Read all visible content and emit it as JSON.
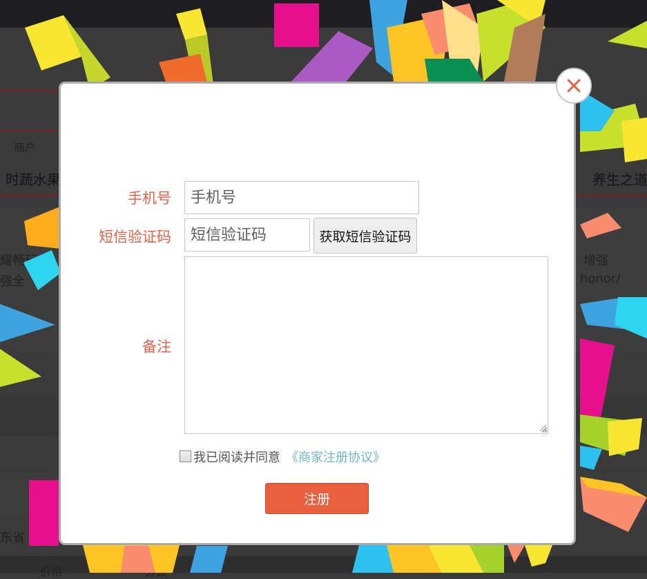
{
  "background": {
    "merchant_label": "商户",
    "nav_left": "时蔬水果",
    "nav_right": "养生之道",
    "product_text_left_1": "耀畅玩",
    "product_text_left_2": "强全",
    "product_text_right_1": "增强",
    "product_text_right_2": "honor/",
    "region": "东省",
    "footer_col_1": "价格",
    "footer_col_2": "分数"
  },
  "form": {
    "phone_label": "手机号",
    "phone_placeholder": "手机号",
    "phone_value": "",
    "sms_label": "短信验证码",
    "sms_placeholder": "短信验证码",
    "sms_value": "",
    "sms_button": "获取短信验证码",
    "remark_label": "备注",
    "remark_value": "",
    "agree_text": "我已阅读并同意",
    "agreement_link": "《商家注册协议》",
    "agree_checked": false,
    "submit_label": "注册"
  },
  "icons": {
    "close": "close-icon",
    "resize": "resize-grip-icon",
    "checkbox": "checkbox-unchecked"
  },
  "colors": {
    "label": "#e2634a",
    "link": "#6fb7c2",
    "submit_bg": "#e9603f",
    "close_x": "#e2634a"
  }
}
